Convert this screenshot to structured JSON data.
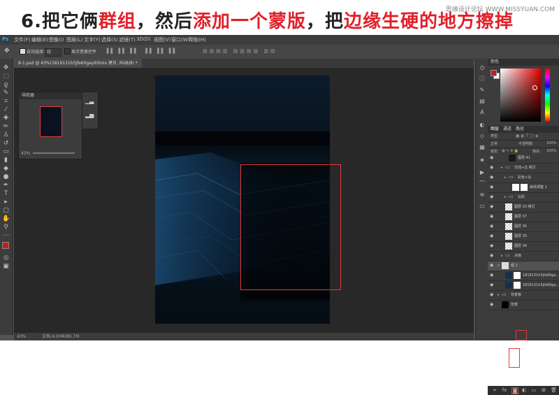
{
  "banner": {
    "parts": [
      {
        "text": "6.把它俩",
        "color": "#222222"
      },
      {
        "text": "群组",
        "color": "#e0212a"
      },
      {
        "text": "，然后",
        "color": "#222222"
      },
      {
        "text": "添加一个蒙版",
        "color": "#e0212a"
      },
      {
        "text": "，把",
        "color": "#222222"
      },
      {
        "text": "边缘生硬的地方擦掉",
        "color": "#e0212a"
      }
    ],
    "watermark": "思缘设计论坛 WWW.MISSYUAN.COM"
  },
  "menubar": {
    "items": [
      "文件(F)",
      "编辑(E)",
      "图像(I)",
      "图层(L)",
      "文字(Y)",
      "选择(S)",
      "滤镜(T)",
      "3D(D)",
      "视图(V)",
      "窗口(W)",
      "帮助(H)"
    ]
  },
  "options": {
    "auto_select": "自动选择：",
    "group_value": "组",
    "show_transform": "显示变换控件"
  },
  "document": {
    "tab_title": "8-1.psd @ 43%(1819131h5jfe60gay93mix 拷贝, RGB/8) *"
  },
  "navigator": {
    "title": "导航器",
    "zoom": "43%"
  },
  "status": {
    "zoom": "43%",
    "doc_info": "文档:4.00M/89.7M"
  },
  "color_panel": {
    "title": "颜色",
    "fg_color": "#c41c1c",
    "bg_color": "#ffffff"
  },
  "layers_panel": {
    "tabs": [
      "图层",
      "通道",
      "路径"
    ],
    "kind_label": "类型",
    "blend_mode": "正常",
    "opacity_label": "不透明度:",
    "opacity_value": "100%",
    "lock_label": "锁定:",
    "fill_label": "填充:",
    "fill_value": "100%",
    "layers": [
      {
        "name": "图层 41",
        "indent": 2,
        "thumb": "dark"
      },
      {
        "name": "光线+云 拷贝",
        "indent": 1,
        "thumb": "group"
      },
      {
        "name": "彩色+云",
        "indent": 2,
        "thumb": "group"
      },
      {
        "name": "曲线调整 1",
        "indent": 3,
        "thumb": "white"
      },
      {
        "name": "云彩",
        "indent": 2,
        "thumb": "group"
      },
      {
        "name": "图层 33 拷贝",
        "indent": 1,
        "thumb": "checker"
      },
      {
        "name": "图层 37",
        "indent": 1,
        "thumb": "checker"
      },
      {
        "name": "图层 36",
        "indent": 1,
        "thumb": "checker"
      },
      {
        "name": "图层 35",
        "indent": 1,
        "thumb": "checker"
      },
      {
        "name": "图层 34",
        "indent": 1,
        "thumb": "checker"
      },
      {
        "name": "冰雨",
        "indent": 1,
        "thumb": "group"
      },
      {
        "name": "组 1",
        "indent": 0,
        "thumb": "mask"
      },
      {
        "name": "1819131h5jfe60ga...",
        "indent": 1,
        "thumb": "photo"
      },
      {
        "name": "1819131h5jfe60ga...",
        "indent": 1,
        "thumb": "photo"
      },
      {
        "name": "背景板",
        "indent": 0,
        "thumb": "group"
      },
      {
        "name": "背景",
        "indent": 0,
        "thumb": "black"
      }
    ]
  },
  "colors": {
    "highlight": "#e23b3b",
    "ps_bg": "#535353",
    "canvas_bg": "#282828"
  }
}
